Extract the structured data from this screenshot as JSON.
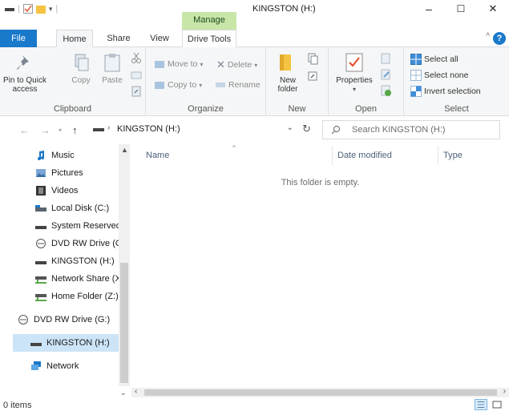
{
  "window": {
    "title": "KINGSTON (H:)",
    "context_tab": "Manage",
    "minimize": "–",
    "maximize": "☐",
    "close": "✕"
  },
  "ribbon_tabs": [
    "File",
    "Home",
    "Share",
    "View",
    "Drive Tools"
  ],
  "help": "?",
  "ribbon": {
    "clipboard": {
      "label": "Clipboard",
      "pin": "Pin to Quick access",
      "copy": "Copy",
      "paste": "Paste"
    },
    "organize": {
      "label": "Organize",
      "move_to": "Move to",
      "copy_to": "Copy to",
      "delete": "Delete",
      "rename": "Rename"
    },
    "new": {
      "label": "New",
      "new_folder": "New folder"
    },
    "open": {
      "label": "Open",
      "properties": "Properties"
    },
    "select": {
      "label": "Select",
      "select_all": "Select all",
      "select_none": "Select none",
      "invert": "Invert selection"
    }
  },
  "address": {
    "path": "KINGSTON (H:)",
    "search_placeholder": "Search KINGSTON (H:)"
  },
  "nav_items": [
    {
      "label": "Music",
      "icon": "music-icon"
    },
    {
      "label": "Pictures",
      "icon": "pictures-icon"
    },
    {
      "label": "Videos",
      "icon": "videos-icon"
    },
    {
      "label": "Local Disk (C:)",
      "icon": "drive-icon"
    },
    {
      "label": "System Reserved",
      "icon": "drive-icon"
    },
    {
      "label": "DVD RW Drive (G:",
      "icon": "dvd-icon"
    },
    {
      "label": "KINGSTON (H:)",
      "icon": "usb-drive-icon"
    },
    {
      "label": "Network Share (X",
      "icon": "network-drive-icon"
    },
    {
      "label": "Home Folder (Z:)",
      "icon": "network-drive-icon"
    },
    {
      "label": "DVD RW Drive (G:)",
      "icon": "dvd-icon"
    },
    {
      "label": "KINGSTON (H:)",
      "icon": "usb-drive-icon"
    },
    {
      "label": "Network",
      "icon": "network-icon"
    }
  ],
  "columns": {
    "name": "Name",
    "date_modified": "Date modified",
    "type": "Type"
  },
  "empty_message": "This folder is empty.",
  "status": {
    "items": "0 items"
  },
  "colors": {
    "accent": "#1979ca",
    "selected": "#cce4f7",
    "manage_tab": "#c8e6a8"
  }
}
